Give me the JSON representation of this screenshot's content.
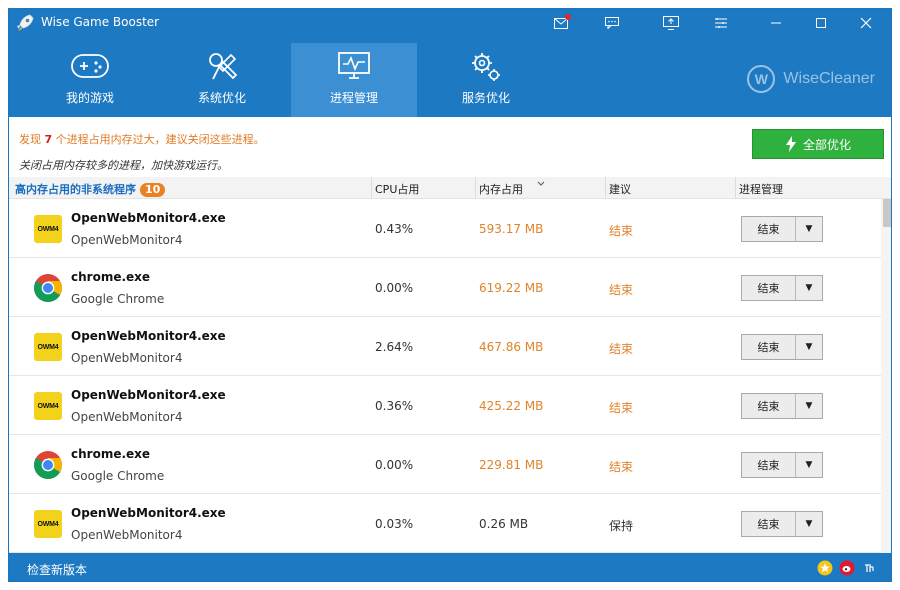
{
  "app": {
    "title": "Wise Game Booster"
  },
  "nav": {
    "tabs": [
      {
        "label": "我的游戏",
        "icon": "gamepad-icon"
      },
      {
        "label": "系统优化",
        "icon": "wrench-screwdriver-icon"
      },
      {
        "label": "进程管理",
        "icon": "monitor-pulse-icon",
        "active": true
      },
      {
        "label": "服务优化",
        "icon": "gears-icon"
      }
    ],
    "brand": "WiseCleaner",
    "brand_logo_letter": "W"
  },
  "info": {
    "line1_prefix": "发现",
    "line1_count": "7",
    "line1_suffix": "个进程占用内存过大，建议关闭这些进程。",
    "line2": "关闭占用内存较多的进程，加快游戏运行。",
    "optimize_all": "全部优化"
  },
  "table": {
    "title": "高内存占用的非系统程序",
    "count": "10",
    "headers": {
      "cpu": "CPU占用",
      "mem": "内存占用",
      "advice": "建议",
      "manage": "进程管理"
    },
    "rows": [
      {
        "icon": "owm",
        "icon_text": "OWM4",
        "name": "OpenWebMonitor4.exe",
        "sub": "OpenWebMonitor4",
        "cpu": "0.43%",
        "mem": "593.17 MB",
        "advice": "结束",
        "end": "结束"
      },
      {
        "icon": "chrome",
        "name": "chrome.exe",
        "sub": "Google Chrome",
        "cpu": "0.00%",
        "mem": "619.22 MB",
        "advice": "结束",
        "end": "结束"
      },
      {
        "icon": "owm",
        "icon_text": "OWM4",
        "name": "OpenWebMonitor4.exe",
        "sub": "OpenWebMonitor4",
        "cpu": "2.64%",
        "mem": "467.86 MB",
        "advice": "结束",
        "end": "结束"
      },
      {
        "icon": "owm",
        "icon_text": "OWM4",
        "name": "OpenWebMonitor4.exe",
        "sub": "OpenWebMonitor4",
        "cpu": "0.36%",
        "mem": "425.22 MB",
        "advice": "结束",
        "end": "结束"
      },
      {
        "icon": "chrome",
        "name": "chrome.exe",
        "sub": "Google Chrome",
        "cpu": "0.00%",
        "mem": "229.81 MB",
        "advice": "结束",
        "end": "结束"
      },
      {
        "icon": "owm",
        "icon_text": "OWM4",
        "name": "OpenWebMonitor4.exe",
        "sub": "OpenWebMonitor4",
        "cpu": "0.03%",
        "mem": "0.26 MB",
        "advice": "保持",
        "end": "结束"
      }
    ]
  },
  "status": {
    "check_update": "检查新版本"
  },
  "colors": {
    "primary": "#1e79c3",
    "active_tab": "#3c8fd2",
    "accent_orange": "#e0842a",
    "optimize_green": "#2eb13d"
  }
}
